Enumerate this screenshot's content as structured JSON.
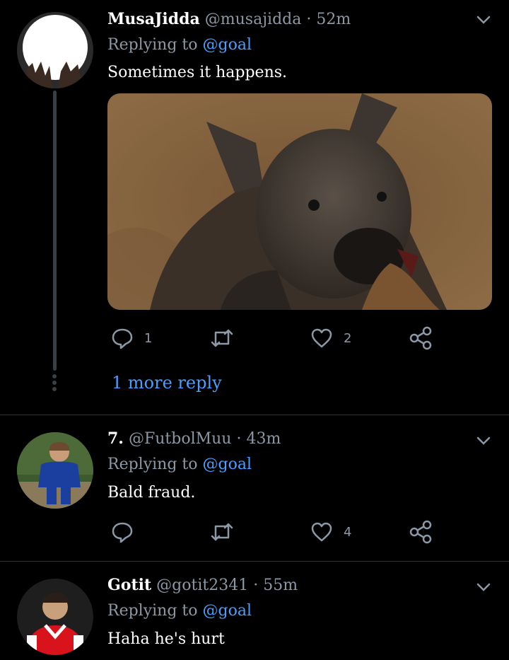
{
  "colors": {
    "background": "#000000",
    "link": "#4a9eff",
    "muted": "#8b98a5",
    "divider": "#2f3336"
  },
  "tweets": [
    {
      "name": "MusaJidda",
      "handle": "@musajidda",
      "separator": "·",
      "time": "52m",
      "replying_prefix": "Replying to",
      "replying_to": "@goal",
      "text": "Sometimes it happens.",
      "media": {
        "description": "hyena photo",
        "icon": "image"
      },
      "reply_count": "1",
      "retweet_count": "",
      "like_count": "2",
      "more_replies": "1 more reply"
    },
    {
      "name": "7.",
      "handle": "@FutbolMuu",
      "separator": "·",
      "time": "43m",
      "replying_prefix": "Replying to",
      "replying_to": "@goal",
      "text": "Bald fraud.",
      "reply_count": "",
      "retweet_count": "",
      "like_count": "4"
    },
    {
      "name": "Gotit",
      "handle": "@gotit2341",
      "separator": "·",
      "time": "55m",
      "replying_prefix": "Replying to",
      "replying_to": "@goal",
      "text": "Haha he's hurt"
    }
  ],
  "icons": [
    "chevron-down-icon",
    "reply-icon",
    "retweet-icon",
    "like-icon",
    "share-icon"
  ]
}
